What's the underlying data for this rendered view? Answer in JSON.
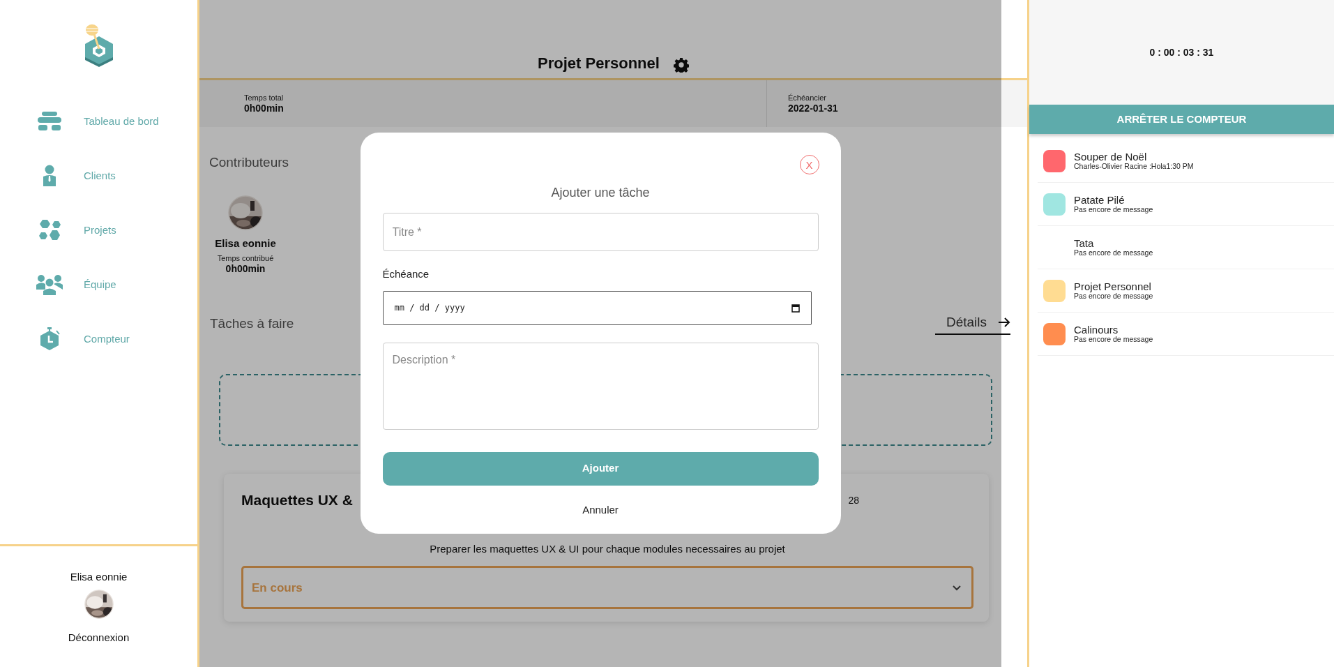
{
  "sidebar": {
    "items": [
      {
        "label": "Tableau de bord"
      },
      {
        "label": "Clients"
      },
      {
        "label": "Projets"
      },
      {
        "label": "Équipe"
      },
      {
        "label": "Compteur"
      }
    ],
    "user": {
      "name": "Elisa eonnie"
    },
    "logout": "Déconnexion"
  },
  "project": {
    "title": "Projet Personnel",
    "stats": [
      {
        "label": "Temps total",
        "value": "0h00min"
      },
      {
        "label": "Échéancier",
        "value": "2022-01-31"
      }
    ],
    "contributors_heading": "Contributeurs",
    "contributors": [
      {
        "name": "Elisa eonnie",
        "time_label": "Temps contribué",
        "time": "0h00min"
      }
    ],
    "tasks_heading": "Tâches à faire",
    "details_link": "Détails",
    "tasks": [
      {
        "title": "Maquettes UX &",
        "date": "28",
        "description": "Preparer les maquettes UX & UI pour chaque modules necessaires au projet",
        "status": "En cours"
      }
    ]
  },
  "modal": {
    "close": "X",
    "title": "Ajouter une tâche",
    "fields": [
      {
        "kind": "text",
        "placeholder": "Titre *"
      },
      {
        "kind": "date",
        "label": "Échéance",
        "placeholder": "mm / dd / yyyy"
      },
      {
        "kind": "textarea",
        "placeholder": "Description *"
      }
    ],
    "submit": "Ajouter",
    "cancel": "Annuler"
  },
  "timer": {
    "time": "0 : 00 : 03 : 31",
    "stop_button": "ARRÊTER LE COMPTEUR"
  },
  "projects": [
    {
      "name": "Souper de Noël",
      "message": "Charles-Olivier Racine :Hola1:30 PM",
      "color": "#ff676d"
    },
    {
      "name": "Patate Pilé",
      "message": "Pas encore de message",
      "color": "#a0e6e1"
    },
    {
      "name": "Tata",
      "message": "Pas encore de message"
    },
    {
      "name": "Projet Personnel",
      "message": "Pas encore de message",
      "color": "#ffdc92"
    },
    {
      "name": "Calinours",
      "message": "Pas encore de message",
      "color": "#ff8d4f"
    }
  ]
}
